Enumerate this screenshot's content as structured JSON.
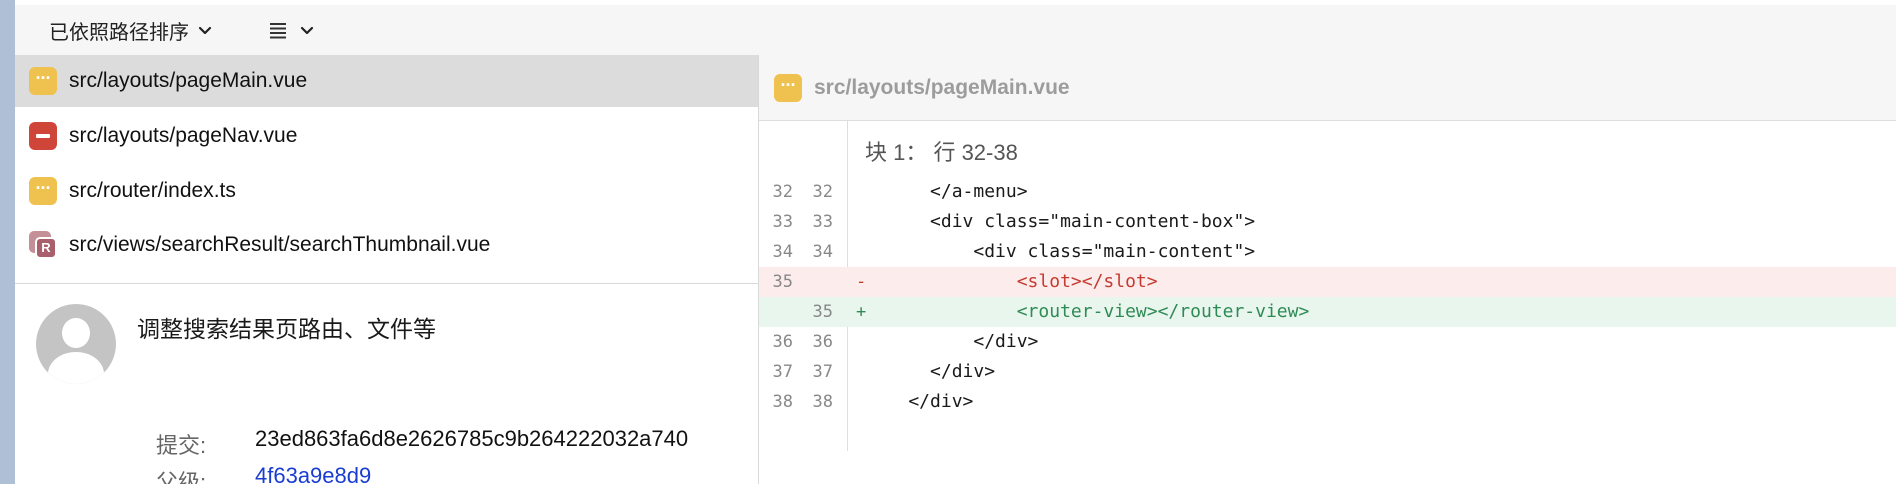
{
  "toolbar": {
    "sort_label": "已依照路径排序"
  },
  "files": [
    {
      "path": "src/layouts/pageMain.vue",
      "status": "modified"
    },
    {
      "path": "src/layouts/pageNav.vue",
      "status": "deleted"
    },
    {
      "path": "src/router/index.ts",
      "status": "modified"
    },
    {
      "path": "src/views/searchResult/searchThumbnail.vue",
      "status": "renamed",
      "badge": "R"
    }
  ],
  "commit": {
    "message": "调整搜索结果页路由、文件等",
    "commit_label": "提交:",
    "commit_hash": "23ed863fa6d8e2626785c9b264222032a740",
    "parent_label": "父级:",
    "parent_hash": "4f63a9e8d9"
  },
  "diff": {
    "filename": "src/layouts/pageMain.vue",
    "hunk_header": "块 1： 行 32-38",
    "lines": [
      {
        "old": "32",
        "new": "32",
        "type": "context",
        "marker": "",
        "code": "      </a-menu>"
      },
      {
        "old": "33",
        "new": "33",
        "type": "context",
        "marker": "",
        "code": "      <div class=\"main-content-box\">"
      },
      {
        "old": "34",
        "new": "34",
        "type": "context",
        "marker": "",
        "code": "          <div class=\"main-content\">"
      },
      {
        "old": "35",
        "new": "",
        "type": "removed",
        "marker": "-",
        "code": "              <slot></slot>"
      },
      {
        "old": "",
        "new": "35",
        "type": "added",
        "marker": "+",
        "code": "              <router-view></router-view>"
      },
      {
        "old": "36",
        "new": "36",
        "type": "context",
        "marker": "",
        "code": "          </div>"
      },
      {
        "old": "37",
        "new": "37",
        "type": "context",
        "marker": "",
        "code": "      </div>"
      },
      {
        "old": "38",
        "new": "38",
        "type": "context",
        "marker": "",
        "code": "    </div>"
      }
    ]
  },
  "colors": {
    "modified": "#efc14e",
    "deleted": "#d0453a",
    "renamed": "#a95f6c",
    "removed_text": "#c53b2f",
    "added_text": "#2f8a55"
  },
  "icons": [
    "chevron-down-icon",
    "list-view-icon",
    "modified-status-icon",
    "deleted-status-icon",
    "renamed-status-icon",
    "avatar-placeholder-icon"
  ]
}
